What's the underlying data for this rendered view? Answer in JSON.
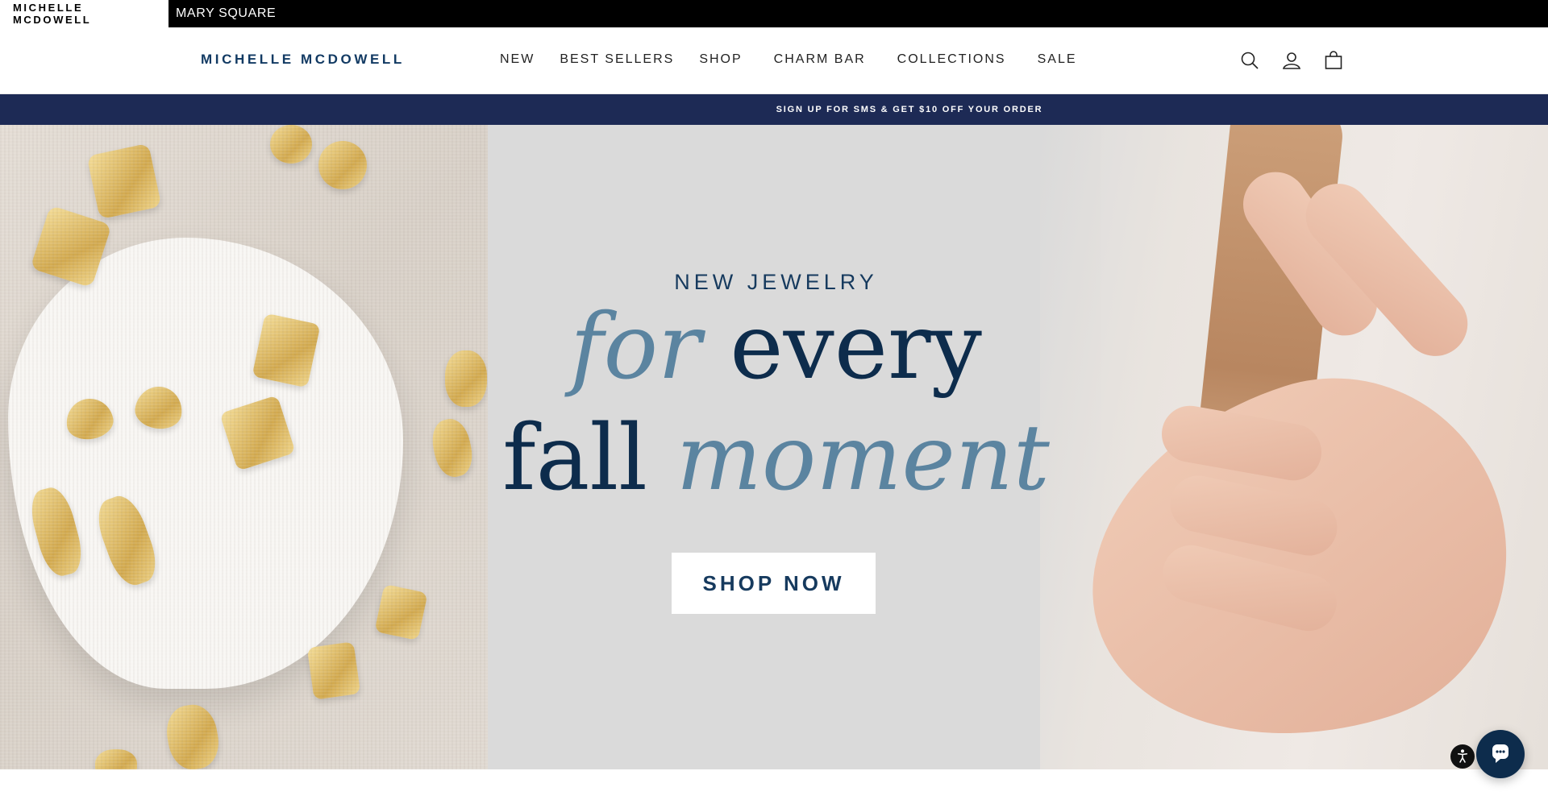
{
  "brand_bar": {
    "tabs": [
      {
        "label": "MICHELLE MCDOWELL"
      },
      {
        "label": "MARY SQUARE"
      }
    ]
  },
  "header": {
    "logo": "MICHELLE MCDOWELL",
    "nav": [
      {
        "label": "NEW"
      },
      {
        "label": "BEST SELLERS"
      },
      {
        "label": "SHOP"
      },
      {
        "label": "CHARM BAR"
      },
      {
        "label": "COLLECTIONS"
      },
      {
        "label": "SALE"
      }
    ],
    "icons": [
      "search-icon",
      "account-icon",
      "cart-icon"
    ]
  },
  "announcement": {
    "text": "SIGN UP FOR SMS & GET $10 OFF YOUR ORDER"
  },
  "hero": {
    "kicker": "NEW JEWELRY",
    "line1_script": "for",
    "line1_roman": "every",
    "line2_roman": "fall",
    "line2_script": "moment",
    "cta": "SHOP NOW"
  },
  "colors": {
    "navy": "#0d2c4c",
    "announcement_bg": "#1d2a55",
    "script_blue": "#5b84a0",
    "gold": "#d2a94e"
  },
  "widgets": {
    "accessibility_icon": "accessibility-icon",
    "chat_icon": "chat-icon"
  }
}
